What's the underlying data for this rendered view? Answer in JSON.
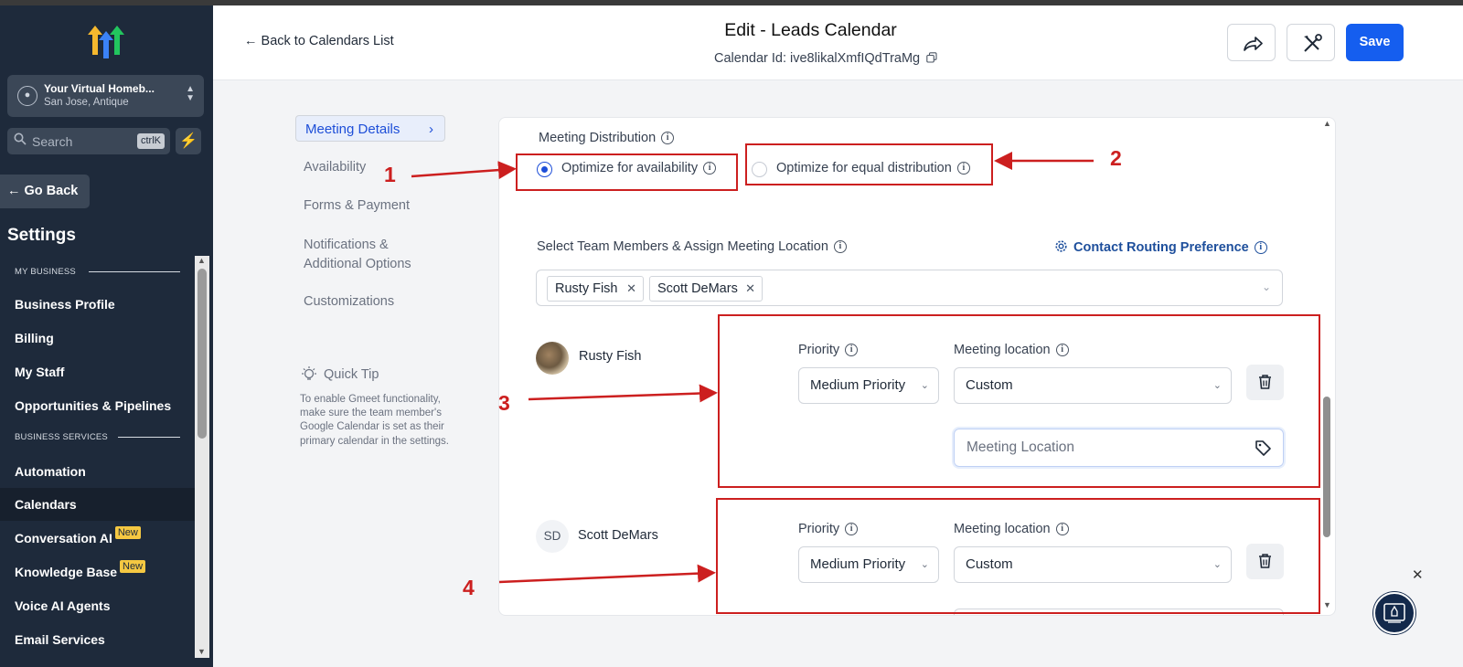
{
  "sidebar": {
    "account_name": "Your Virtual Homeb...",
    "account_location": "San Jose, Antique",
    "search_placeholder": "Search",
    "search_shortcut": "ctrlK",
    "go_back": "Go Back",
    "settings_title": "Settings",
    "section_my_business": "MY BUSINESS",
    "section_business_services": "BUSINESS SERVICES",
    "items": {
      "business_profile": "Business Profile",
      "billing": "Billing",
      "my_staff": "My Staff",
      "opportunities": "Opportunities & Pipelines",
      "automation": "Automation",
      "calendars": "Calendars",
      "conversation_ai": "Conversation AI",
      "knowledge_base": "Knowledge Base",
      "voice_ai": "Voice AI Agents",
      "email_services": "Email Services"
    },
    "badge_new": "New",
    "active_item": "Calendars"
  },
  "header": {
    "back_label": "Back to Calendars List",
    "title": "Edit - Leads Calendar",
    "calendar_id": "Calendar Id: ive8likalXmfIQdTraMg",
    "save_label": "Save"
  },
  "left_nav": {
    "meeting_details": "Meeting Details",
    "availability": "Availability",
    "forms_payment": "Forms & Payment",
    "notifications_line1": "Notifications &",
    "notifications_line2": "Additional Options",
    "customizations": "Customizations",
    "quick_tip_title": "Quick Tip",
    "quick_tip_body": "To enable Gmeet functionality, make sure the team member's Google Calendar is set as their primary calendar in the settings."
  },
  "form": {
    "meeting_distribution_label": "Meeting Distribution",
    "option_availability": "Optimize for availability",
    "option_equal": "Optimize for equal distribution",
    "selected_option": "Optimize for availability",
    "team_members_label": "Select Team Members & Assign Meeting Location",
    "contact_routing": "Contact Routing Preference",
    "chips": [
      "Rusty Fish",
      "Scott DeMars"
    ],
    "members": [
      {
        "name": "Rusty Fish",
        "priority_label": "Priority",
        "priority_value": "Medium Priority",
        "location_label": "Meeting location",
        "location_value": "Custom",
        "location_placeholder": "Meeting Location"
      },
      {
        "name": "Scott DeMars",
        "initials": "SD",
        "priority_label": "Priority",
        "priority_value": "Medium Priority",
        "location_label": "Meeting location",
        "location_value": "Custom"
      }
    ]
  },
  "annotations": [
    "1",
    "2",
    "3",
    "4"
  ],
  "colors": {
    "sidebar_bg": "#1e2a3b",
    "primary": "#155eef",
    "annotation_red": "#cc1f1f",
    "badge_yellow": "#f5c842"
  }
}
